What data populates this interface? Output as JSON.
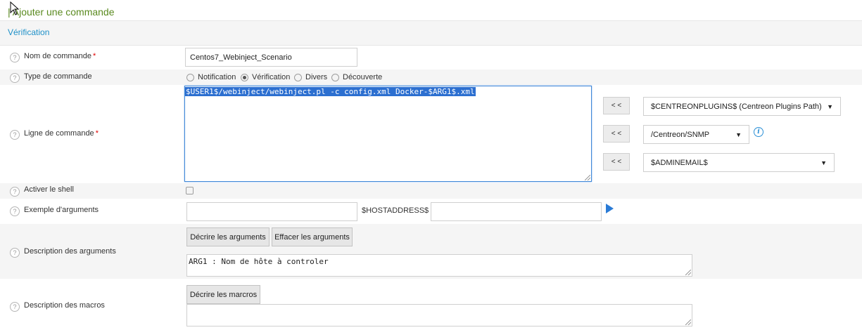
{
  "page": {
    "title": "| Ajouter une commande",
    "section": "Vérification"
  },
  "form": {
    "command_name": {
      "label": "Nom de commande",
      "required_mark": "*",
      "value": "Centos7_Webinject_Scenario"
    },
    "command_type": {
      "label": "Type de commande",
      "options": [
        "Notification",
        "Vérification",
        "Divers",
        "Découverte"
      ],
      "selected": "Vérification"
    },
    "command_line": {
      "label": "Ligne de commande",
      "required_mark": "*",
      "value": "$USER1$/webinject/webinject.pl -c config.xml Docker-$ARG1$.xml",
      "insert_button_label": "< <",
      "macro_selects": [
        {
          "value": "$CENTREONPLUGINS$ (Centreon Plugins Path)"
        },
        {
          "value": "/Centreon/SNMP"
        },
        {
          "value": "$ADMINEMAIL$"
        }
      ]
    },
    "enable_shell": {
      "label": "Activer le shell",
      "checked": false
    },
    "argument_example": {
      "label": "Exemple d'arguments",
      "host_address_label": "$HOSTADDRESS$",
      "value": "",
      "host_value": ""
    },
    "argument_description": {
      "label": "Description des arguments",
      "describe_button": "Décrire les arguments",
      "clear_button": "Effacer les arguments",
      "value": "ARG1 : Nom de hôte à controler"
    },
    "macro_description": {
      "label": "Description des macros",
      "describe_button": "Décrire les marcros",
      "value": ""
    }
  },
  "icons": {
    "help": "?",
    "info": "i",
    "caret": "▼"
  },
  "colors": {
    "title_green": "#5a8a1f",
    "section_blue": "#1e90c8",
    "selection_blue": "#2c6fd0",
    "required_red": "#e00000"
  }
}
